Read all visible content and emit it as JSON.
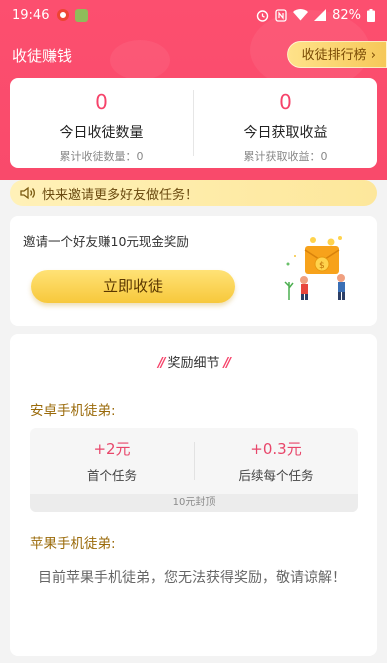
{
  "status_bar": {
    "time": "19:46",
    "battery": "82%"
  },
  "header": {
    "title": "收徒赚钱",
    "rank_button": "收徒排行榜 ›"
  },
  "stats": {
    "left": {
      "value": "0",
      "label": "今日收徒数量",
      "sub": "累计收徒数量：0"
    },
    "right": {
      "value": "0",
      "label": "今日获取收益",
      "sub": "累计获取收益：0"
    }
  },
  "notice": {
    "text": "快来邀请更多好友做任务！",
    "icon": "speaker-icon"
  },
  "invite": {
    "description": "邀请一个好友赚10元现金奖励",
    "button": "立即收徒"
  },
  "reward": {
    "title": "奖励细节",
    "android": {
      "title": "安卓手机徒弟:",
      "first": {
        "value": "+2元",
        "caption": "首个任务"
      },
      "next": {
        "value": "+0.3元",
        "caption": "后续每个任务"
      },
      "cap": "10元封顶"
    },
    "ios": {
      "title": "苹果手机徒弟:",
      "text": "目前苹果手机徒弟，您无法获得奖励，敬请谅解！"
    }
  },
  "colors": {
    "primary": "#f94a6b",
    "gold": "#f7c83b",
    "accent_text": "#9a6a0a"
  }
}
